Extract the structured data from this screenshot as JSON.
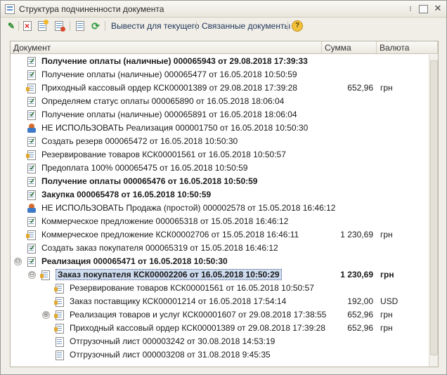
{
  "window": {
    "title": "Структура подчиненности документа",
    "more_glyph": "⁝",
    "close_glyph": "✕"
  },
  "toolbar": {
    "print_for_current": "Вывести для текущего",
    "related_docs": "Связанные документы",
    "help_glyph": "?",
    "edit_glyph": "✎",
    "refresh_glyph": "⟳"
  },
  "table": {
    "headers": {
      "document": "Документ",
      "amount": "Сумма",
      "currency": "Валюта"
    },
    "rows": [
      {
        "name": "Получение оплаты (наличные) 000065943 от 29.08.2018 17:39:33",
        "amount": "",
        "currency": "",
        "bold": true,
        "icon": "check",
        "level": 0
      },
      {
        "name": "Получение оплаты (наличные) 000065477 от 16.05.2018 10:50:59",
        "amount": "",
        "currency": "",
        "bold": false,
        "icon": "check",
        "level": 0
      },
      {
        "name": "Приходный кассовый ордер КСК00001389 от 29.08.2018 17:39:28",
        "amount": "652,96",
        "currency": "грн",
        "bold": false,
        "icon": "posted",
        "level": 0
      },
      {
        "name": "Определяем статус оплаты 000065890 от 16.05.2018 18:06:04",
        "amount": "",
        "currency": "",
        "bold": false,
        "icon": "check",
        "level": 0
      },
      {
        "name": "Получение оплаты (наличные) 000065891 от 16.05.2018 18:06:04",
        "amount": "",
        "currency": "",
        "bold": false,
        "icon": "check",
        "level": 0
      },
      {
        "name": "НЕ ИСПОЛЬЗОВАТЬ Реализация 000001750 от 16.05.2018 10:50:30",
        "amount": "",
        "currency": "",
        "bold": false,
        "icon": "mark",
        "level": 0
      },
      {
        "name": "Создать резерв 000065472 от 16.05.2018 10:50:30",
        "amount": "",
        "currency": "",
        "bold": false,
        "icon": "check",
        "level": 0
      },
      {
        "name": "Резервирование товаров КСК00001561 от 16.05.2018 10:50:57",
        "amount": "",
        "currency": "",
        "bold": false,
        "icon": "posted",
        "level": 0
      },
      {
        "name": "Предоплата 100% 000065475 от 16.05.2018 10:50:59",
        "amount": "",
        "currency": "",
        "bold": false,
        "icon": "check",
        "level": 0
      },
      {
        "name": "Получение оплаты 000065476 от 16.05.2018 10:50:59",
        "amount": "",
        "currency": "",
        "bold": true,
        "icon": "check",
        "level": 0
      },
      {
        "name": "Закупка 000065478 от 16.05.2018 10:50:59",
        "amount": "",
        "currency": "",
        "bold": true,
        "icon": "check",
        "level": 0
      },
      {
        "name": "НЕ ИСПОЛЬЗОВАТЬ Продажа (простой) 000002578 от 15.05.2018 16:46:12",
        "amount": "",
        "currency": "",
        "bold": false,
        "icon": "mark",
        "level": 0
      },
      {
        "name": "Коммерческое предложение 000065318 от 15.05.2018 16:46:12",
        "amount": "",
        "currency": "",
        "bold": false,
        "icon": "check",
        "level": 0
      },
      {
        "name": "Коммерческое предложение КСК00002706 от 15.05.2018 16:46:11",
        "amount": "1 230,69",
        "currency": "грн",
        "bold": false,
        "icon": "posted",
        "level": 0
      },
      {
        "name": "Создать заказ покупателя 000065319 от 15.05.2018 16:46:12",
        "amount": "",
        "currency": "",
        "bold": false,
        "icon": "check",
        "level": 0
      },
      {
        "name": "Реализация 000065471 от 16.05.2018 10:50:30",
        "amount": "",
        "currency": "",
        "bold": true,
        "icon": "check",
        "level": 0,
        "toggle": "⊖"
      },
      {
        "name": "Заказ покупателя КСК00002206 от 16.05.2018 10:50:29",
        "amount": "1 230,69",
        "currency": "грн",
        "bold": true,
        "icon": "posted",
        "level": 1,
        "toggle": "⊖",
        "selected": true
      },
      {
        "name": "Резервирование товаров КСК00001561 от 16.05.2018 10:50:57",
        "amount": "",
        "currency": "",
        "bold": false,
        "icon": "posted",
        "level": 2
      },
      {
        "name": "Заказ поставщику КСК00001214 от 16.05.2018 17:54:14",
        "amount": "192,00",
        "currency": "USD",
        "bold": false,
        "icon": "posted",
        "level": 2
      },
      {
        "name": "Реализация товаров и услуг КСК00001607 от 29.08.2018 17:38:55",
        "amount": "652,96",
        "currency": "грн",
        "bold": false,
        "icon": "posted",
        "level": 2,
        "toggle": "⊕"
      },
      {
        "name": "Приходный кассовый ордер КСК00001389 от 29.08.2018 17:39:28",
        "amount": "652,96",
        "currency": "грн",
        "bold": false,
        "icon": "posted",
        "level": 2
      },
      {
        "name": "Отгрузочный лист 000003242 от 30.08.2018 14:53:19",
        "amount": "",
        "currency": "",
        "bold": false,
        "icon": "plain",
        "level": 2
      },
      {
        "name": "Отгрузочный лист 000003208 от 31.08.2018 9:45:35",
        "amount": "",
        "currency": "",
        "bold": false,
        "icon": "plain",
        "level": 2
      }
    ]
  }
}
